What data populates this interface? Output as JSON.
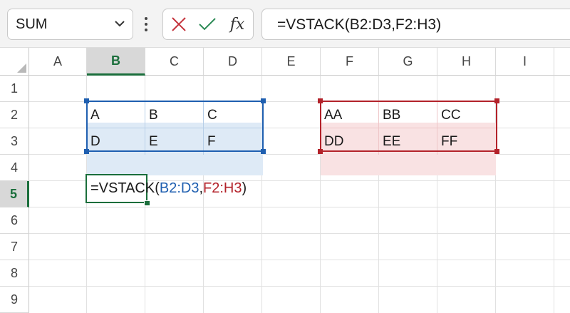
{
  "name_box": {
    "value": "SUM"
  },
  "formula_bar": {
    "cancel_icon": "x-icon",
    "enter_icon": "check-icon",
    "function_label": "fx",
    "formula": "=VSTACK(B2:D3,F2:H3)"
  },
  "columns": [
    "A",
    "B",
    "C",
    "D",
    "E",
    "F",
    "G",
    "H",
    "I"
  ],
  "rows": [
    "1",
    "2",
    "3",
    "4",
    "5",
    "6",
    "7",
    "8",
    "9"
  ],
  "selected_column": "B",
  "selected_row": "5",
  "range1": {
    "ref": "B2:D3",
    "color": "#1f5fb0",
    "cells": [
      [
        "A",
        "B",
        "C"
      ],
      [
        "D",
        "E",
        "F"
      ]
    ]
  },
  "range2": {
    "ref": "F2:H3",
    "color": "#b3222a",
    "cells": [
      [
        "AA",
        "BB",
        "CC"
      ],
      [
        "DD",
        "EE",
        "FF"
      ]
    ]
  },
  "editing_cell": {
    "ref": "B5",
    "prefix": "=VSTACK(",
    "arg1": "B2:D3",
    "sep": ",",
    "arg2": "F2:H3",
    "suffix": ")"
  }
}
